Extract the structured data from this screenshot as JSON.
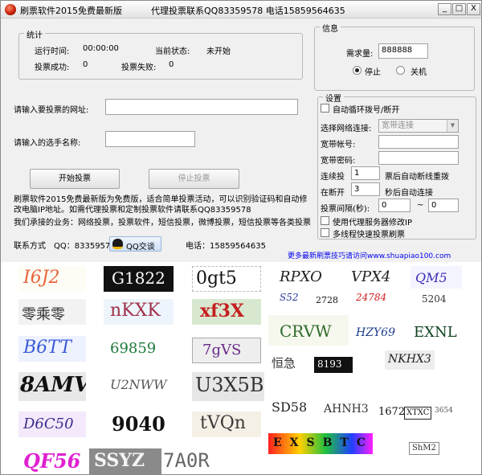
{
  "window": {
    "title": "刷票软件2015免费最新版",
    "title_contact": "代理投票联系QQ83359578 电话15859564635",
    "minimize": "_",
    "maximize": "□",
    "close": "X"
  },
  "stats": {
    "group_title": "统计",
    "runtime_label": "运行时间:",
    "runtime_value": "00:00:00",
    "status_label": "当前状态:",
    "status_value": "未开始",
    "success_label": "投票成功:",
    "success_value": "0",
    "fail_label": "投票失败:",
    "fail_value": "0"
  },
  "form": {
    "url_label": "请输入要投票的网址:",
    "url_value": "",
    "name_label": "请输入的选手名称:",
    "name_value": "",
    "start_button": "开始投票",
    "stop_button": "停止投票"
  },
  "info": {
    "group_title": "信息",
    "demand_label": "需求量:",
    "demand_value": "888888",
    "radio_stop": "停止",
    "radio_shutdown": "关机"
  },
  "settings": {
    "group_title": "设置",
    "auto_dial_label": "自动循环拨号/断开",
    "network_label": "选择网络连接:",
    "network_value": "宽带连接",
    "account_label": "宽带帐号:",
    "account_value": "",
    "password_label": "宽带密码:",
    "password_value": "",
    "continuous_label": "连续投",
    "continuous_value": "1",
    "continuous_suffix": "票后自动断线重拨",
    "disconnected_label": "在断开",
    "disconnected_value": "3",
    "disconnected_suffix": "秒后自动连接",
    "interval_label": "投票间隔(秒):",
    "interval_from": "0",
    "interval_sep": "~",
    "interval_to": "0",
    "proxy_label": "使用代理服务器修改IP",
    "multithread_label": "多线程快速投票刷票"
  },
  "description": {
    "line1": "刷票软件2015免费最新版为免费版，适合简单投票活动，可以识别验证码和自动修改电脑IP地址。如需代理投票和定制投票软件请联系QQ83359578",
    "line2": "我们承接的业务：网络投票，投票软件，短信投票，微博投票，短信投票等各类投票"
  },
  "contact": {
    "label": "联系方式",
    "qq": "QQ：83359578",
    "qq_button": "QQ交谈",
    "phone": "电话：15859564635",
    "more_link": "更多最新刷票技巧请访问www.shuapiao100.com"
  },
  "captchas": [
    "I6J2",
    "G1822",
    "0gt5",
    "RPXO",
    "VPX4",
    "QM5",
    "零乘零",
    "nKXK",
    "xf3X",
    "S52",
    "2728",
    "24784",
    "5204",
    "B6TT",
    "69859",
    "7gVS",
    "CRVW",
    "HZY69",
    "EXNL",
    "8AMV",
    "U2NWW",
    "U3X5B",
    "恒急",
    "8193",
    "NKHX3",
    "D6C50",
    "9040",
    "tVQn",
    "SD58",
    "AHNH3",
    "1672",
    "XTXC",
    "3654",
    "QF56",
    "SSYZ",
    "7A0R",
    "EXSBTC",
    "ShM2"
  ],
  "colors": {
    "window_bg": "#f0f0f0",
    "link": "#0000ee",
    "icon_red": "#c21a00"
  }
}
